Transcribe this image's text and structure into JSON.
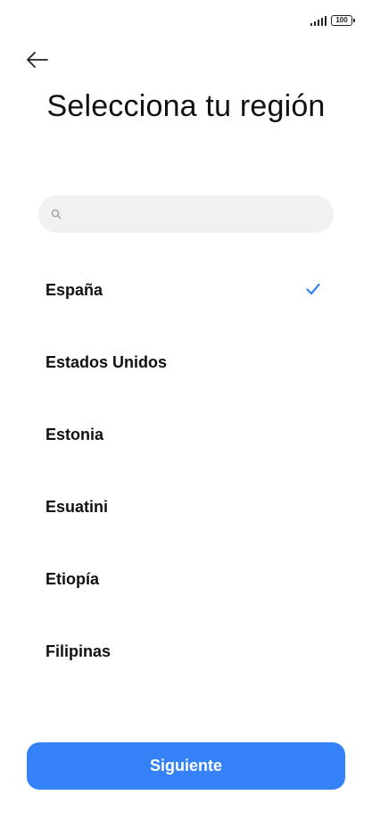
{
  "status_bar": {
    "signal_icon": "cellular-signal-icon",
    "battery_level": "100"
  },
  "header": {
    "back_icon": "arrow-left-icon",
    "title": "Selecciona tu región"
  },
  "search": {
    "icon": "search-icon",
    "value": "",
    "placeholder": ""
  },
  "regions": [
    {
      "label": "España",
      "selected": true
    },
    {
      "label": "Estados Unidos",
      "selected": false
    },
    {
      "label": "Estonia",
      "selected": false
    },
    {
      "label": "Esuatini",
      "selected": false
    },
    {
      "label": "Etiopía",
      "selected": false
    },
    {
      "label": "Filipinas",
      "selected": false
    }
  ],
  "footer": {
    "next_label": "Siguiente"
  },
  "colors": {
    "accent": "#3582f8",
    "search_bg": "#f1f1f1",
    "text": "#111111"
  }
}
